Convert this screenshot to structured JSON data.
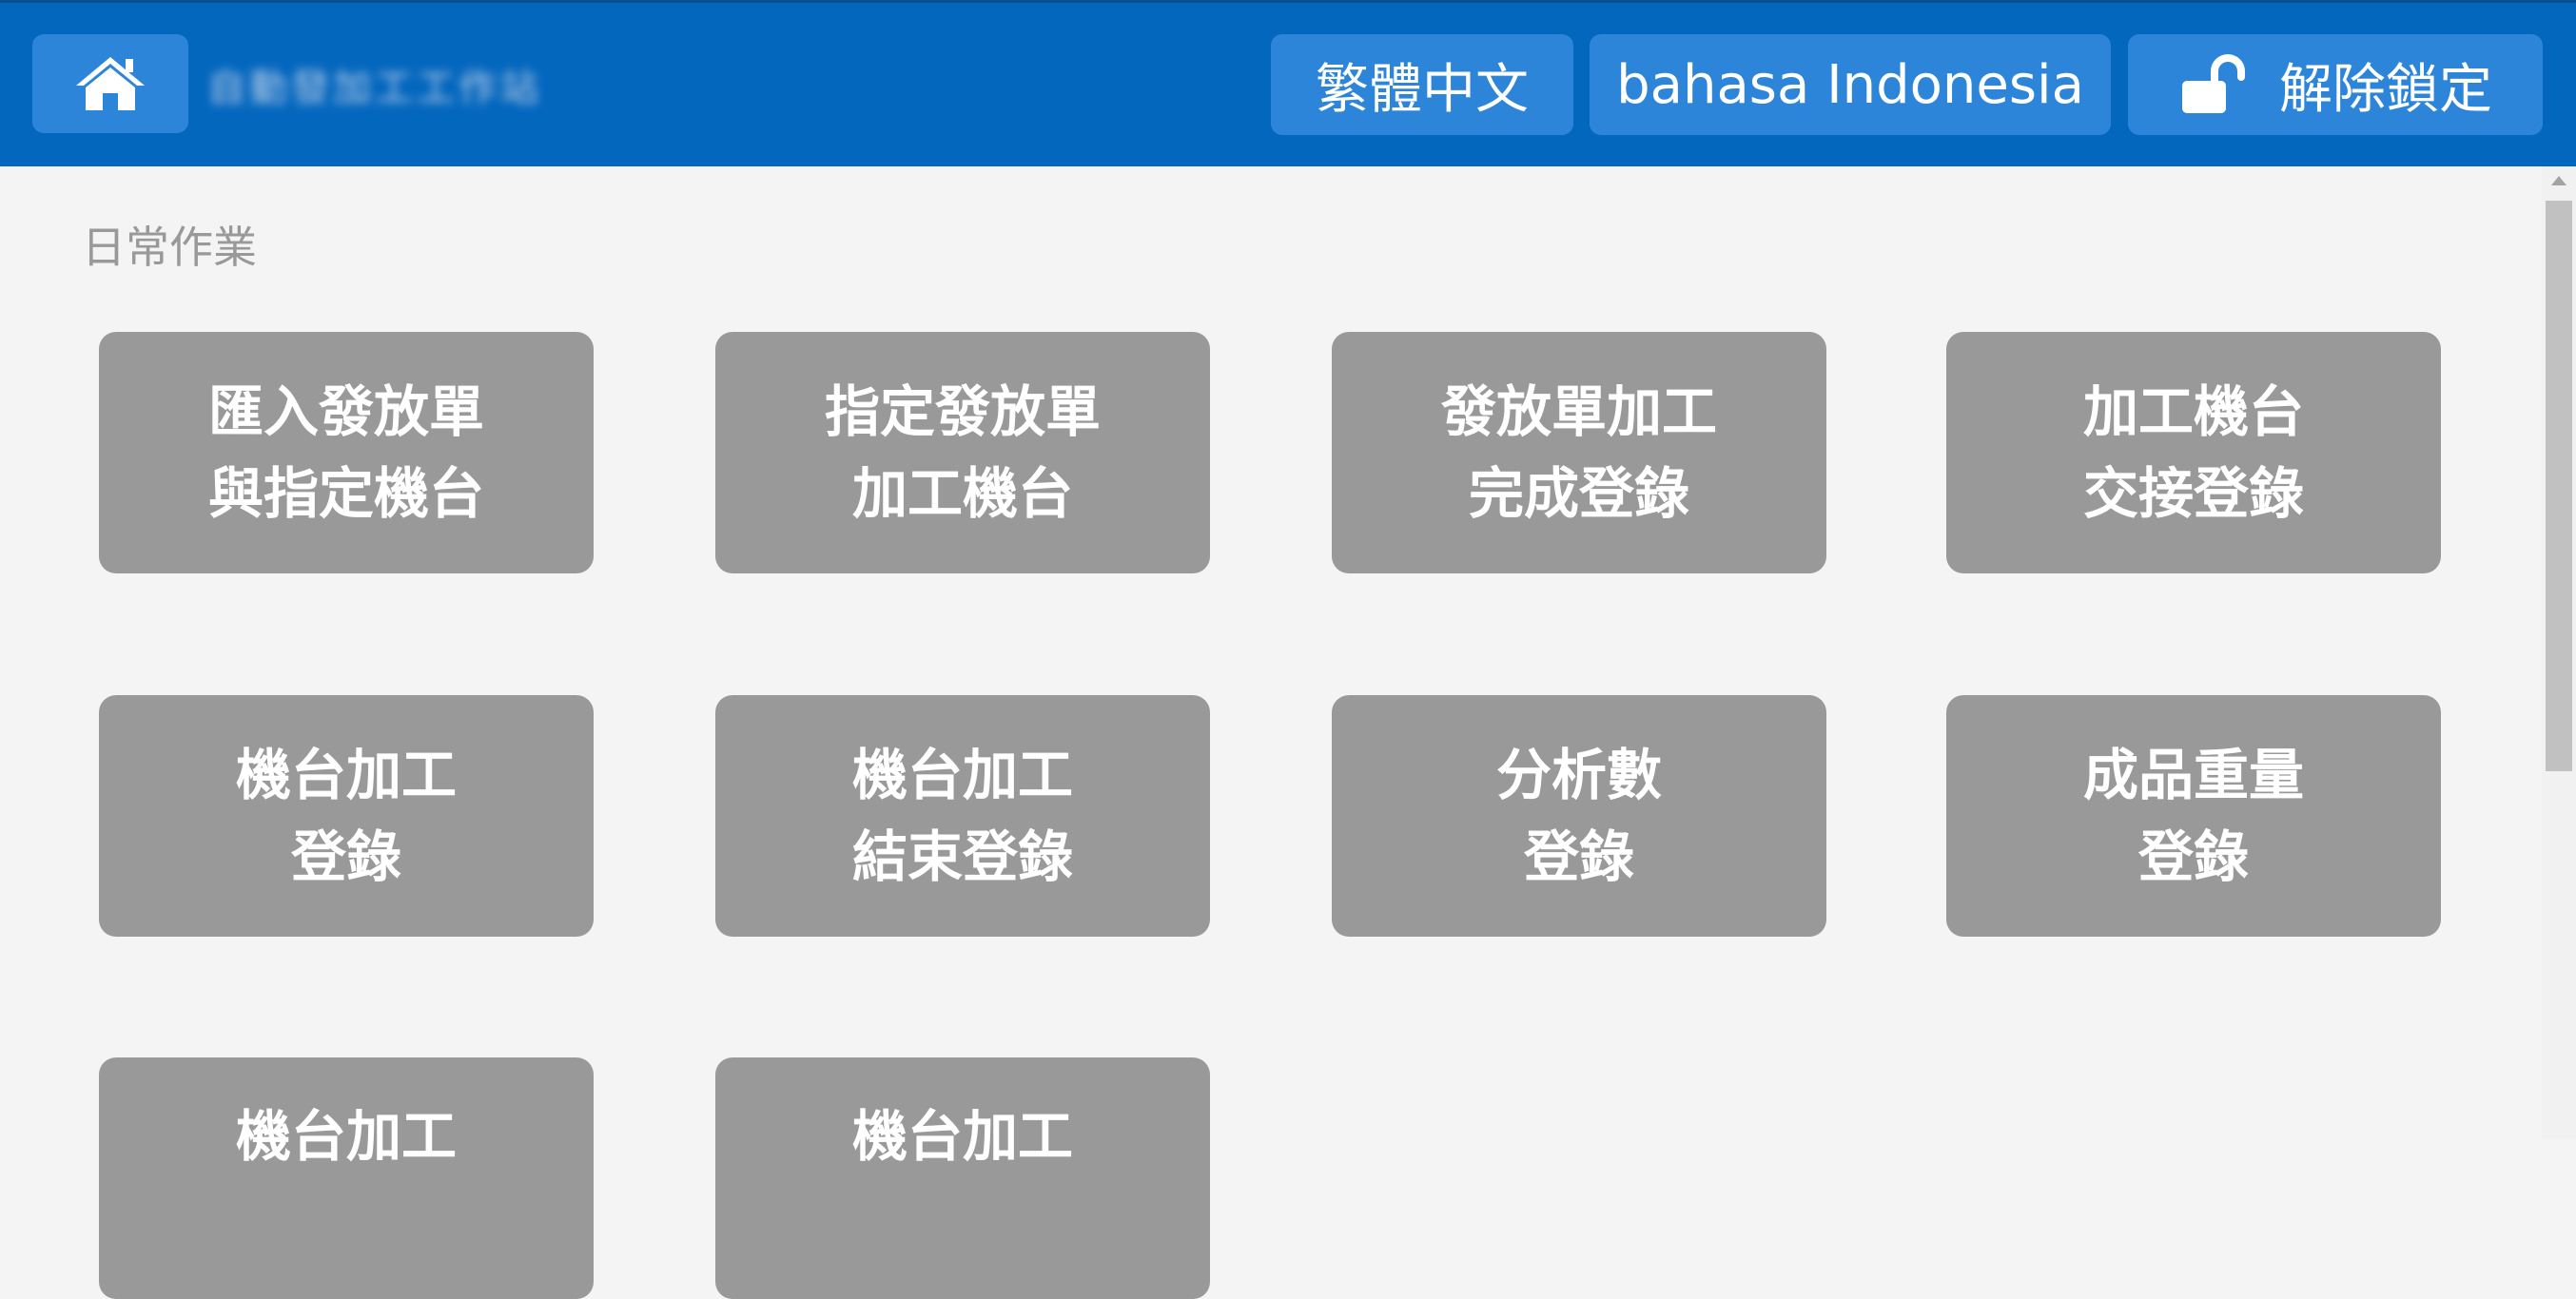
{
  "header": {
    "home_icon": "home-icon",
    "app_title_blurred": "自動發加工工作站",
    "lang_zh_label": "繁體中文",
    "lang_id_label": "bahasa Indonesia",
    "unlock_label": "解除鎖定",
    "unlock_icon": "unlock-icon",
    "bar_color": "#0467be",
    "button_color": "#2d85da"
  },
  "section": {
    "title": "日常作業"
  },
  "tiles": [
    {
      "line1": "匯入發放單",
      "line2": "與指定機台"
    },
    {
      "line1": "指定發放單",
      "line2": "加工機台"
    },
    {
      "line1": "發放單加工",
      "line2": "完成登錄"
    },
    {
      "line1": "加工機台",
      "line2": "交接登錄"
    },
    {
      "line1": "機台加工",
      "line2": "登錄"
    },
    {
      "line1": "機台加工",
      "line2": "結束登錄"
    },
    {
      "line1": "分析數",
      "line2": "登錄"
    },
    {
      "line1": "成品重量",
      "line2": "登錄"
    },
    {
      "line1": "機台加工",
      "line2": ""
    },
    {
      "line1": "機台加工",
      "line2": ""
    }
  ],
  "tile_color": "#999999"
}
